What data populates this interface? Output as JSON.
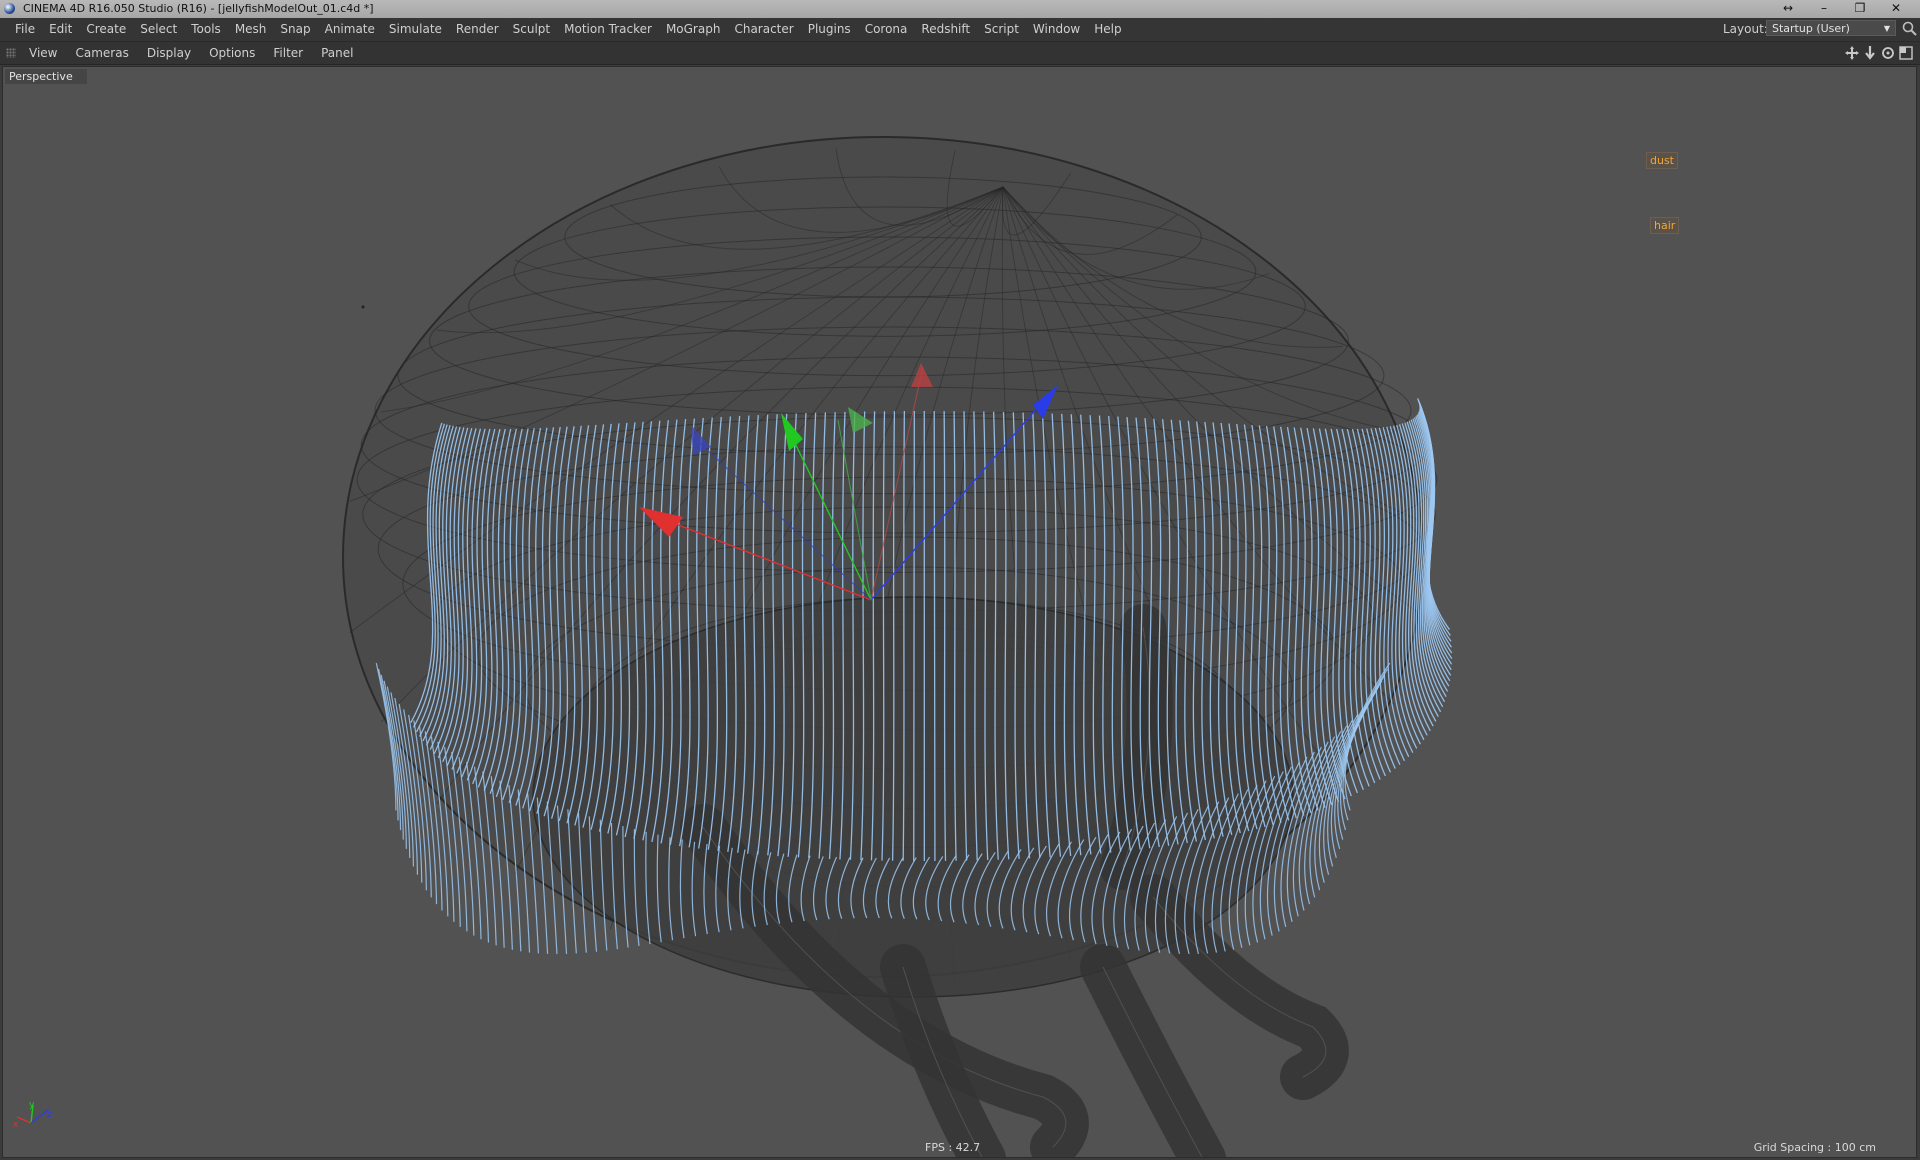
{
  "window": {
    "title": "CINEMA 4D R16.050 Studio (R16) - [jellyfishModelOut_01.c4d *]",
    "controls": [
      "↔",
      "–",
      "❐",
      "✕"
    ]
  },
  "menubar": {
    "items": [
      "File",
      "Edit",
      "Create",
      "Select",
      "Tools",
      "Mesh",
      "Snap",
      "Animate",
      "Simulate",
      "Render",
      "Sculpt",
      "Motion Tracker",
      "MoGraph",
      "Character",
      "Plugins",
      "Corona",
      "Redshift",
      "Script",
      "Window",
      "Help"
    ],
    "layout_label": "Layout:",
    "layout_value": "Startup (User)"
  },
  "viewbar": {
    "items": [
      "View",
      "Cameras",
      "Display",
      "Options",
      "Filter",
      "Panel"
    ]
  },
  "viewport": {
    "camera": "Perspective",
    "tags": [
      "dust",
      "hair"
    ],
    "fps": "FPS : 42.7",
    "grid_spacing": "Grid Spacing : 100 cm",
    "axis_labels": [
      "x",
      "y",
      "z"
    ],
    "colors": {
      "background": "#525252",
      "hair": "#9cc8f2",
      "wire": "#262626",
      "x_axis": "#e03030",
      "y_axis": "#22c822",
      "z_axis": "#2a3ce6"
    }
  }
}
